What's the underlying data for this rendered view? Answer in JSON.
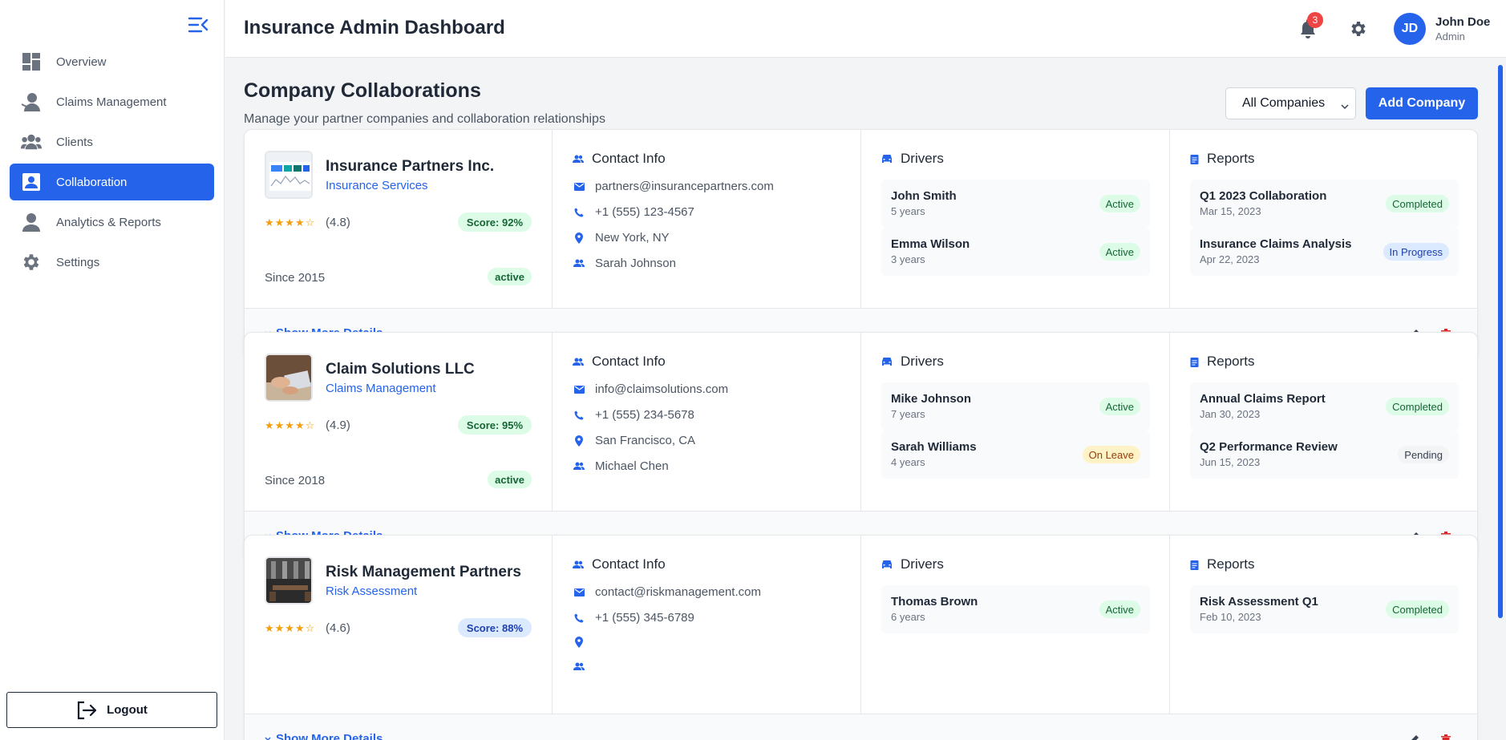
{
  "app": {
    "title": "Insurance Admin Dashboard"
  },
  "sidebar": {
    "items": [
      {
        "label": "Overview",
        "icon": "dashboard-icon",
        "active": false
      },
      {
        "label": "Claims Management",
        "icon": "person-claim-icon",
        "active": false
      },
      {
        "label": "Clients",
        "icon": "group-icon",
        "active": false
      },
      {
        "label": "Collaboration",
        "icon": "contact-card-icon",
        "active": true
      },
      {
        "label": "Analytics & Reports",
        "icon": "person-icon",
        "active": false
      },
      {
        "label": "Settings",
        "icon": "gear-icon",
        "active": false
      }
    ],
    "logout_label": "Logout"
  },
  "header": {
    "notifications_count": "3",
    "user": {
      "initials": "JD",
      "name": "John Doe",
      "role": "Admin"
    }
  },
  "page": {
    "title": "Company Collaborations",
    "subtitle": "Manage your partner companies and collaboration relationships",
    "filter_value": "All Companies",
    "add_button": "Add Company"
  },
  "labels": {
    "contact_info": "Contact Info",
    "drivers": "Drivers",
    "reports": "Reports",
    "show_more": "Show More Details"
  },
  "colors": {
    "accent": "#2563eb",
    "success_bg": "#dcfce7",
    "success_text": "#166534",
    "warn_bg": "#fef3c7",
    "info_bg": "#dbeafe",
    "danger": "#dc2626"
  },
  "companies": [
    {
      "name": "Insurance Partners Inc.",
      "type": "Insurance Services",
      "stars": "★★★★☆",
      "rating": "(4.8)",
      "score": "Score: 92%",
      "score_style": "green",
      "since": "Since 2015",
      "status": "active",
      "email": "partners@insurancepartners.com",
      "phone": "+1 (555) 123-4567",
      "location": "New York, NY",
      "contact": "Sarah Johnson",
      "drivers": [
        {
          "name": "John Smith",
          "years": "5 years",
          "status": "Active",
          "style": "green"
        },
        {
          "name": "Emma Wilson",
          "years": "3 years",
          "status": "Active",
          "style": "green"
        }
      ],
      "reports": [
        {
          "title": "Q1 2023 Collaboration",
          "date": "Mar 15, 2023",
          "status": "Completed",
          "style": "green"
        },
        {
          "title": "Insurance Claims Analysis",
          "date": "Apr 22, 2023",
          "status": "In Progress",
          "style": "blue"
        }
      ]
    },
    {
      "name": "Claim Solutions LLC",
      "type": "Claims Management",
      "stars": "★★★★☆",
      "rating": "(4.9)",
      "score": "Score: 95%",
      "score_style": "green",
      "since": "Since 2018",
      "status": "active",
      "email": "info@claimsolutions.com",
      "phone": "+1 (555) 234-5678",
      "location": "San Francisco, CA",
      "contact": "Michael Chen",
      "drivers": [
        {
          "name": "Mike Johnson",
          "years": "7 years",
          "status": "Active",
          "style": "green"
        },
        {
          "name": "Sarah Williams",
          "years": "4 years",
          "status": "On Leave",
          "style": "yellow"
        }
      ],
      "reports": [
        {
          "title": "Annual Claims Report",
          "date": "Jan 30, 2023",
          "status": "Completed",
          "style": "green"
        },
        {
          "title": "Q2 Performance Review",
          "date": "Jun 15, 2023",
          "status": "Pending",
          "style": "gray"
        }
      ]
    },
    {
      "name": "Risk Management Partners",
      "type": "Risk Assessment",
      "stars": "★★★★☆",
      "rating": "(4.6)",
      "score": "Score: 88%",
      "score_style": "blue",
      "since": "",
      "status": "",
      "email": "contact@riskmanagement.com",
      "phone": "+1 (555) 345-6789",
      "location": "",
      "contact": "",
      "drivers": [
        {
          "name": "Thomas Brown",
          "years": "6 years",
          "status": "Active",
          "style": "green"
        }
      ],
      "reports": [
        {
          "title": "Risk Assessment Q1",
          "date": "Feb 10, 2023",
          "status": "Completed",
          "style": "green"
        }
      ]
    }
  ]
}
